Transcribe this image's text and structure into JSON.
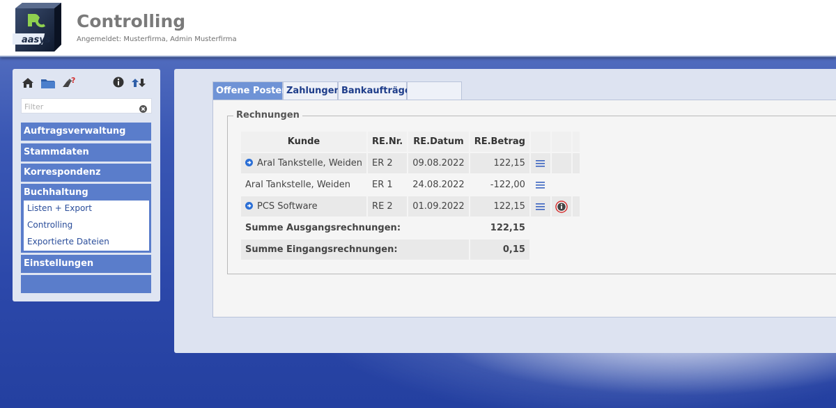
{
  "header": {
    "title": "Controlling",
    "login_info": "Angemeldet: Musterfirma, Admin Musterfirma",
    "logo_text": "aasys"
  },
  "sidebar": {
    "icons": [
      "home-icon",
      "folder-icon",
      "logout-icon",
      "info-icon",
      "refresh-icon"
    ],
    "filter_placeholder": "Filter",
    "menu": [
      {
        "label": "Auftragsverwaltung"
      },
      {
        "label": "Stammdaten"
      },
      {
        "label": "Korrespondenz"
      },
      {
        "label": "Buchhaltung"
      },
      {
        "label": "Einstellungen"
      },
      {
        "label": ""
      }
    ],
    "submenu": [
      {
        "label": "Listen + Export"
      },
      {
        "label": "Controlling"
      },
      {
        "label": "Exportierte Dateien"
      }
    ]
  },
  "tabs": [
    {
      "label": "Offene Posten",
      "active": true
    },
    {
      "label": "Zahlungen",
      "active": false
    },
    {
      "label": "Bankaufträge",
      "active": false
    }
  ],
  "invoices": {
    "legend": "Rechnungen",
    "columns": [
      "Kunde",
      "RE.Nr.",
      "RE.Datum",
      "RE.Betrag"
    ],
    "rows": [
      {
        "kunde": "Aral Tankstelle, Weiden",
        "nr": "ER 2",
        "datum": "09.08.2022",
        "betrag": "122,15"
      },
      {
        "kunde": "Aral Tankstelle, Weiden",
        "nr": "ER 1",
        "datum": "24.08.2022",
        "betrag": "-122,00"
      },
      {
        "kunde": "PCS Software",
        "nr": "RE 2",
        "datum": "01.09.2022",
        "betrag": "122,15"
      }
    ],
    "sum_out_label": "Summe Ausgangsrechnungen:",
    "sum_out_value": "122,15",
    "sum_in_label": "Summe Eingangsrechnungen:",
    "sum_in_value": "0,15"
  },
  "colors": {
    "accent": "#5a7dcb",
    "active_tab": "#6f93d6",
    "negative": "#c9282d"
  }
}
